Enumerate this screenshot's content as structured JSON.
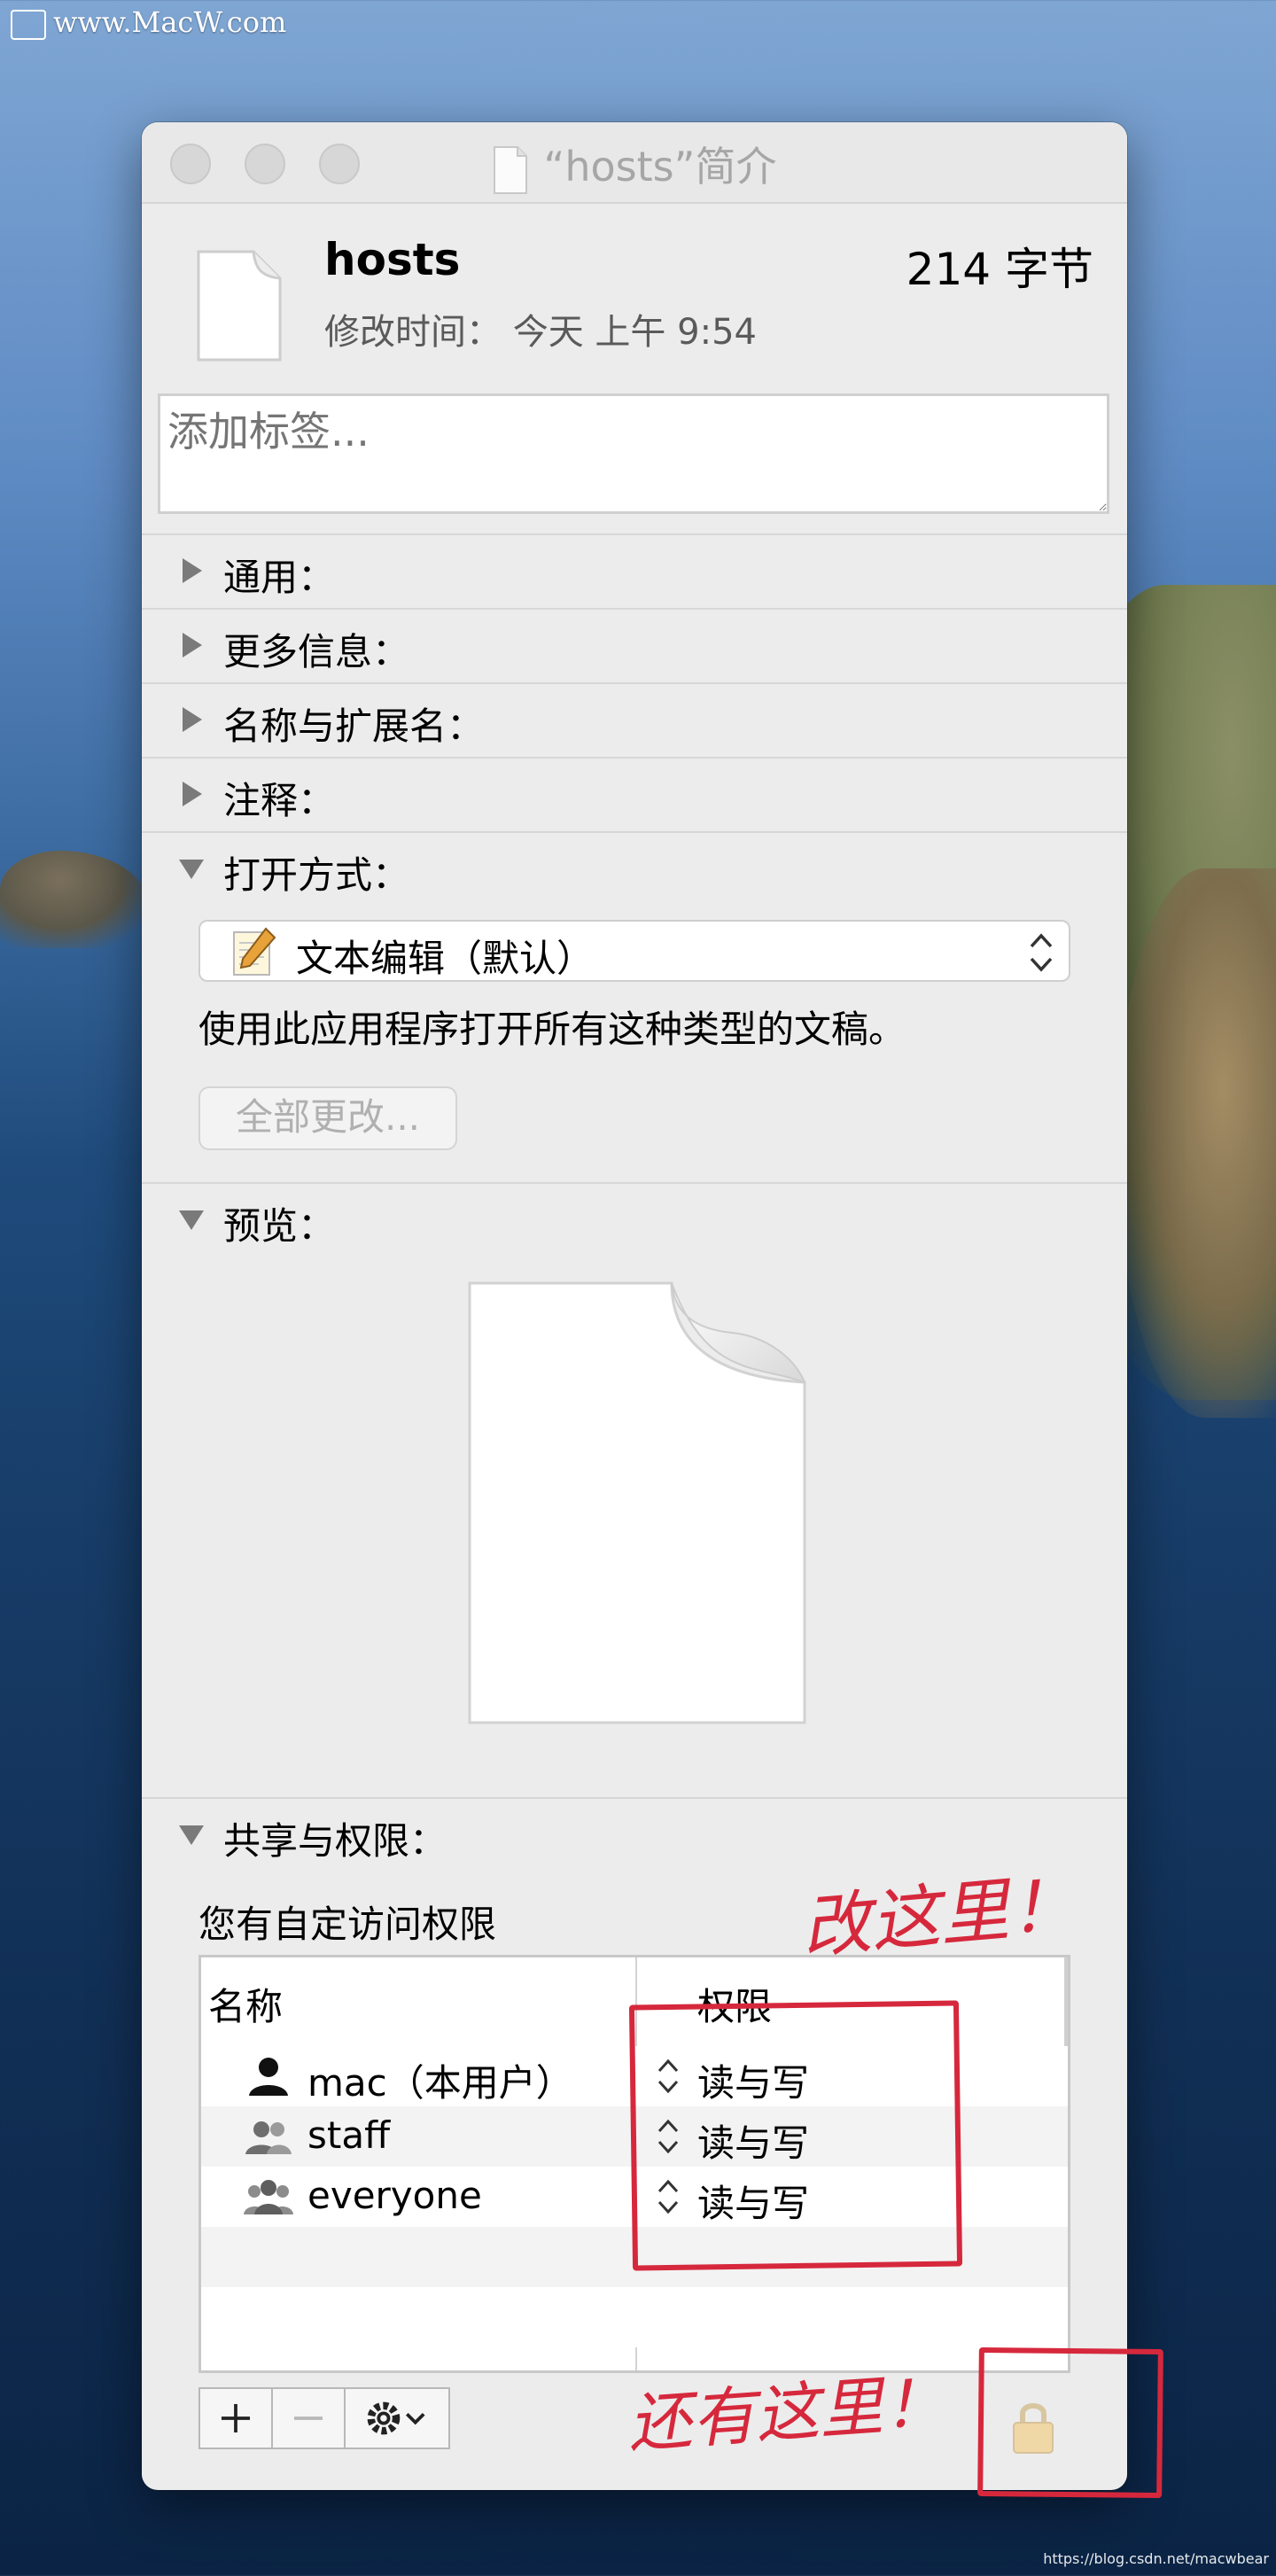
{
  "desktop": {
    "watermark": "www.MacW.com",
    "credit": "https://blog.csdn.net/macwbear"
  },
  "window": {
    "title": "“hosts”简介"
  },
  "file": {
    "name": "hosts",
    "size": "214 字节",
    "modified": "修改时间：  今天 上午 9:54"
  },
  "tags": {
    "placeholder": "添加标签..."
  },
  "sections": {
    "general": "通用：",
    "more_info": "更多信息：",
    "name_ext": "名称与扩展名：",
    "comments": "注释：",
    "open_with": "打开方式：",
    "preview": "预览：",
    "sharing": "共享与权限："
  },
  "open_with": {
    "selected_app": "文本编辑（默认）",
    "description": "使用此应用程序打开所有这种类型的文稿。",
    "change_all": "全部更改..."
  },
  "sharing": {
    "access_text": "您有自定访问权限",
    "col_name": "名称",
    "col_privilege": "权限",
    "rows": [
      {
        "name": "mac（本用户）",
        "privilege": "读与写"
      },
      {
        "name": "staff",
        "privilege": "读与写"
      },
      {
        "name": "everyone",
        "privilege": "读与写"
      }
    ]
  },
  "annotations": {
    "change_here": "改这里！",
    "also_here": "还有这里！",
    "color": "#d6283c"
  }
}
